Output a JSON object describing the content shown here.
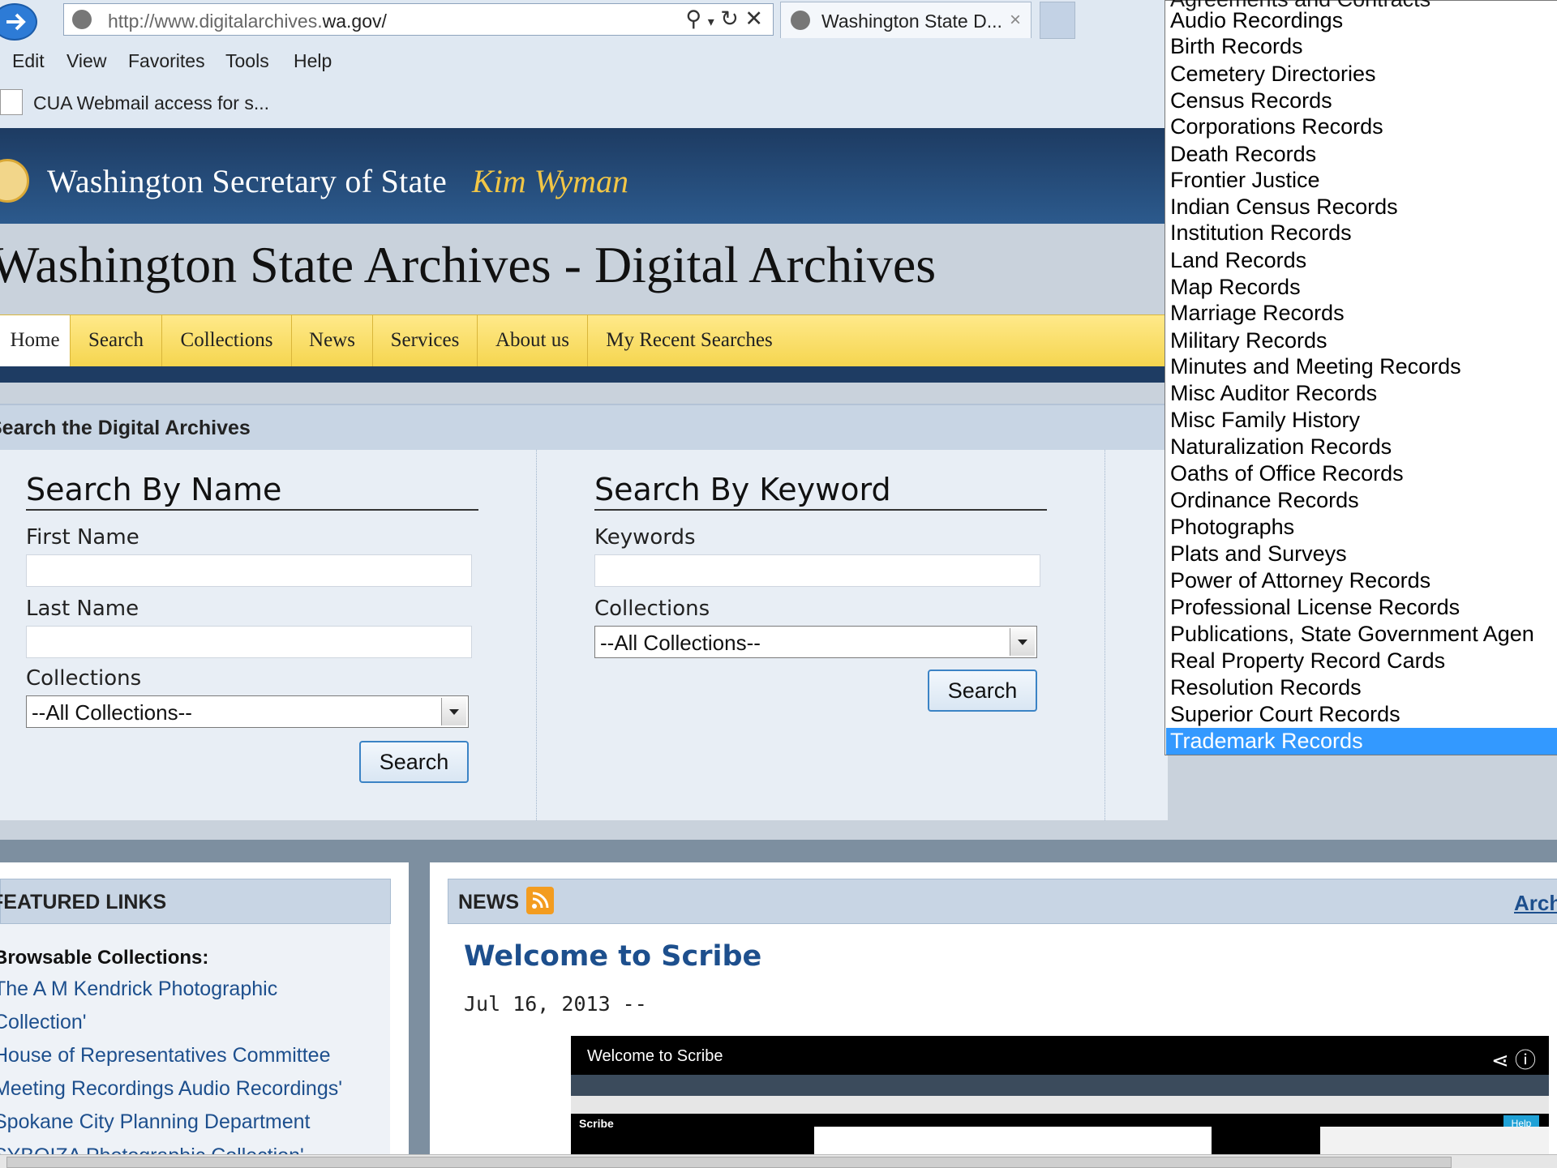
{
  "browser": {
    "url_prefix": "http://www.digitalarchives.",
    "url_domain": "wa.gov/",
    "tab_title": "Washington State D...",
    "tab_close": "×",
    "menu": [
      "Edit",
      "View",
      "Favorites",
      "Tools",
      "Help"
    ],
    "favorite": "CUA Webmail access for s..."
  },
  "site": {
    "office": "Washington Secretary of State",
    "official": "Kim Wyman",
    "title": "Washington State Archives - Digital Archives",
    "nav": [
      "Home",
      "Search",
      "Collections",
      "News",
      "Services",
      "About us",
      "My Recent Searches"
    ]
  },
  "search": {
    "header": "Search the Digital Archives",
    "by_name": {
      "title": "Search By Name",
      "first_label": "First Name",
      "last_label": "Last Name",
      "collections_label": "Collections",
      "collections_value": "--All Collections--",
      "button": "Search"
    },
    "by_keyword": {
      "title": "Search By Keyword",
      "keywords_label": "Keywords",
      "collections_label": "Collections",
      "collections_value": "--All Collections--",
      "button": "Search"
    }
  },
  "dropdown": {
    "partial_top": "Agreements and Contracts",
    "options": [
      "Audio Recordings",
      "Birth Records",
      "Cemetery Directories",
      "Census Records",
      "Corporations Records",
      "Death Records",
      "Frontier Justice",
      "Indian Census Records",
      "Institution Records",
      "Land Records",
      "Map Records",
      "Marriage Records",
      "Military Records",
      "Minutes and Meeting Records",
      "Misc Auditor Records",
      "Misc Family History",
      "Naturalization Records",
      "Oaths of Office Records",
      "Ordinance Records",
      "Photographs",
      "Plats and Surveys",
      "Power of Attorney Records",
      "Professional License Records",
      "Publications, State Government Agen",
      "Real Property Record Cards",
      "Resolution Records",
      "Superior Court Records"
    ],
    "selected": "Trademark Records"
  },
  "featured": {
    "header": "FEATURED LINKS",
    "browsable": "Browsable Collections:",
    "links": [
      "The A M Kendrick Photographic",
      "Collection'",
      "House of Representatives Committee",
      "Meeting Recordings Audio Recordings'",
      "Spokane City Planning Department",
      "SYBOIZA Photographic Collection'"
    ]
  },
  "news": {
    "header": "NEWS",
    "archive": "Archive",
    "title": "Welcome to Scribe",
    "date": "Jul 16, 2013 --",
    "video_title": "Welcome to Scribe",
    "video_app": "Scribe",
    "video_help": "Help"
  }
}
